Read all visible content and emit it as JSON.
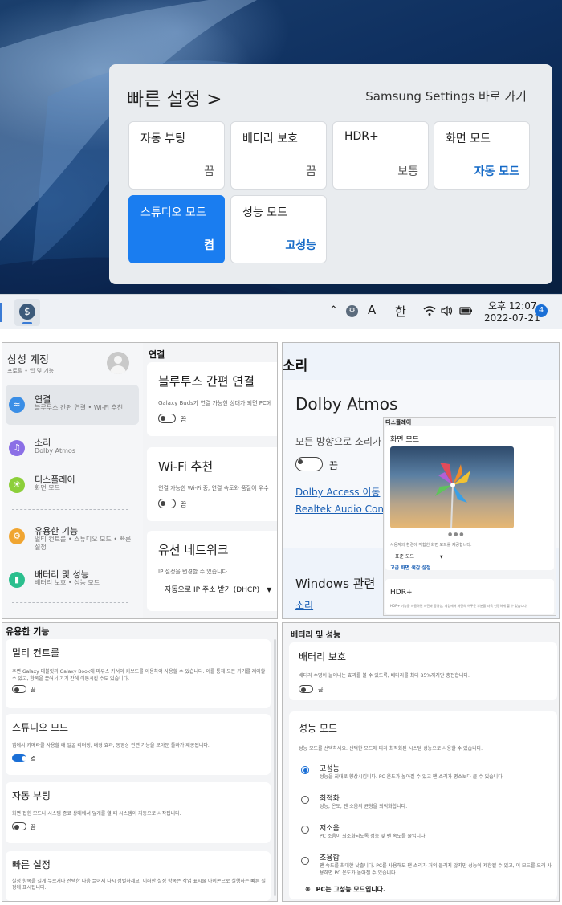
{
  "quick_settings": {
    "title": "빠른 설정 >",
    "samsung_link": "Samsung Settings 바로 가기",
    "tiles": [
      {
        "label": "자동 부팅",
        "value": "끔",
        "active": false
      },
      {
        "label": "배터리 보호",
        "value": "끔",
        "active": false
      },
      {
        "label": "HDR+",
        "value": "보통",
        "active": false
      },
      {
        "label": "화면 모드",
        "value": "자동 모드",
        "active": false
      },
      {
        "label": "스튜디오 모드",
        "value": "켬",
        "active": true
      },
      {
        "label": "성능 모드",
        "value": "고성능",
        "active": false
      }
    ]
  },
  "taskbar": {
    "app_icon": "samsung-settings-icon",
    "tray": {
      "chevron": "^",
      "ime_a": "A",
      "ime_han": "한"
    },
    "clock_time": "오후 12:07",
    "clock_date": "2022-07-21",
    "notifications": "4"
  },
  "settings_sidebar": {
    "account_title": "삼성 계정",
    "account_sub": "프로필 • 앱 및 기능",
    "items": [
      {
        "name": "연결",
        "sub": "블루투스 간편 연결 • Wi-Fi 추천",
        "color": "#3a8ee6",
        "icon": "wifi-icon"
      },
      {
        "name": "소리",
        "sub": "Dolby Atmos",
        "color": "#8b6fe6",
        "icon": "speaker-icon"
      },
      {
        "name": "디스플레이",
        "sub": "화면 모드",
        "color": "#8ccf3a",
        "icon": "sun-icon"
      },
      {
        "name": "유용한 기능",
        "sub": "멀티 컨트롤 • 스튜디오 모드 • 빠른 설정",
        "color": "#f0a531",
        "icon": "gear-icon"
      },
      {
        "name": "배터리 및 성능",
        "sub": "배터리 보호 • 성능 모드",
        "color": "#2bbf8e",
        "icon": "battery-icon"
      }
    ]
  },
  "connection": {
    "heading": "연결",
    "bluetooth_title": "블루투스 간편 연결",
    "bluetooth_desc": "Galaxy Buds가 연결 가능한 상태가 되면 PC에 ",
    "bluetooth_state": "끔",
    "wifi_title": "Wi-Fi 추천",
    "wifi_desc": "연결 가능한 Wi-Fi 중, 연결 속도와 품질이 우수",
    "wifi_state": "끔",
    "wired_title": "유선 네트워크",
    "wired_desc": "IP 설정을 변경할 수 있습니다.",
    "wired_select": "자동으로 IP 주소 받기 (DHCP)"
  },
  "sound": {
    "heading": "소리",
    "dolby_title": "Dolby Atmos",
    "dolby_desc": "모든 방향으로 소리가",
    "dolby_state": "끔",
    "dolby_link": "Dolby Access 이동",
    "realtek_link": "Realtek Audio Cons",
    "windows_title": "Windows 관련",
    "windows_link": "소리"
  },
  "display": {
    "heading": "디스플레이",
    "mode_title": "화면 모드",
    "mode_caption": "사용자의 환경에 적합한 화면 모드를 제공합니다.",
    "mode_select": "표준 모드",
    "advanced_link": "고급 화면 색감 설정",
    "hdr_title": "HDR+",
    "hdr_desc": "HDR+ 기능을 사용하면 사진과 동영상, 게임에서 화면의 어두운 부분을 더욱 선명하게 볼 수 있습니다."
  },
  "useful": {
    "heading": "유용한 기능",
    "multi_title": "멀티 컨트롤",
    "multi_desc": "주변 Galaxy 태블릿과 Galaxy Book에 마우스 커서와 키보드를 이용하여 사용할 수 있습니다. 이를 통해 모든 기기를 제어할 수 있고, 항목을 끌어서 기기 간에 이동시킬 수도 있습니다.",
    "multi_state": "끔",
    "studio_title": "스튜디오 모드",
    "studio_desc": "앱에서 카메라를 사용할 때 얼굴 리터칭, 배경 효과, 동영상 관련 기능을 모아둔 툴바가 제공됩니다.",
    "studio_state": "켬",
    "autoboot_title": "자동 부팅",
    "autoboot_desc": "화면 접힌 모드나 시스템 종료 상태에서 덮개를 열 때 시스템이 자동으로 시작됩니다.",
    "autoboot_state": "끔",
    "quick_title": "빠른 설정",
    "quick_desc": "설정 항목을 길게 누르거나 선택한 다음 끌어서 다시 정렬하세요. 이러한 설정 항목은 작업 표시줄 아이콘으로 실행하는 빠른 설정에 표시됩니다."
  },
  "battery": {
    "heading": "배터리 및 성능",
    "protect_title": "배터리 보호",
    "protect_desc": "배터리 수명이 늘어나는 효과를 볼 수 있도록, 배터리를 최대 85%까지만 충전합니다.",
    "protect_state": "끔",
    "perf_title": "성능 모드",
    "perf_desc": "성능 모드를 선택하세요. 선택한 모드에 따라 최적화된 시스템 성능으로 사용할 수 있습니다.",
    "options": [
      {
        "name": "고성능",
        "desc": "성능을 최대로 향상시킵니다. PC 온도가 높아질 수 있고 팬 소리가 평소보다 클 수 있습니다.",
        "selected": true
      },
      {
        "name": "최적화",
        "desc": "성능, 온도, 팬 소음의 균형을 최적화합니다.",
        "selected": false
      },
      {
        "name": "저소음",
        "desc": "PC 소음이 최소화되도록 성능 및 팬 속도를 줄입니다.",
        "selected": false
      },
      {
        "name": "조용함",
        "desc": "팬 속도를 최대한 낮춥니다. PC를 사용해도 팬 소리가 거의 들리지 않지만 성능이 제한될 수 있고, 이 모드를 오래 사용하면 PC 온도가 높아질 수 있습니다.",
        "selected": false
      }
    ],
    "status": "PC는 고성능 모드입니다."
  }
}
